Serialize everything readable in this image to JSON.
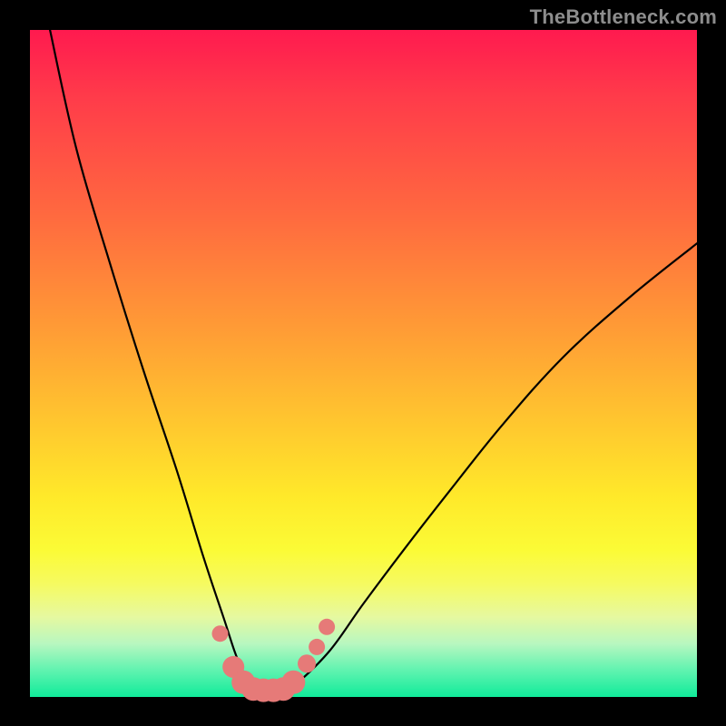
{
  "watermark": "TheBottleneck.com",
  "chart_data": {
    "type": "line",
    "title": "",
    "xlabel": "",
    "ylabel": "",
    "xlim": [
      0,
      100
    ],
    "ylim": [
      0,
      100
    ],
    "grid": false,
    "series": [
      {
        "name": "bottleneck-curve",
        "x": [
          3,
          7,
          12,
          17,
          22,
          26,
          29,
          31,
          33,
          35,
          37,
          40,
          45,
          50,
          56,
          63,
          71,
          80,
          90,
          100
        ],
        "values": [
          100,
          82,
          65,
          49,
          34,
          21,
          12,
          6,
          2,
          0,
          0,
          2,
          7,
          14,
          22,
          31,
          41,
          51,
          60,
          68
        ]
      }
    ],
    "markers": {
      "name": "salmon-dots",
      "x": [
        28.5,
        30.5,
        32,
        33.5,
        35,
        36.5,
        38,
        39.5,
        41.5,
        43.0,
        44.5
      ],
      "values": [
        9.5,
        4.5,
        2.2,
        1.2,
        1.0,
        1.0,
        1.2,
        2.2,
        5.0,
        7.5,
        10.5
      ],
      "radius": [
        9,
        12,
        13,
        13,
        13,
        13,
        13,
        13,
        10,
        9,
        9
      ],
      "color": "#e67a78"
    },
    "background_gradient": {
      "top": "#ff1a4f",
      "bottom": "#10eb9a"
    }
  }
}
